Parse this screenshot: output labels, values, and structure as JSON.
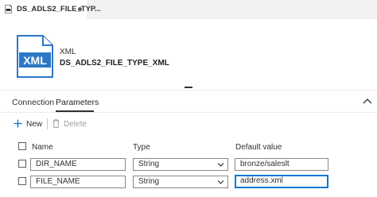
{
  "tab": {
    "title": "DS_ADLS2_FILE_TYP..."
  },
  "dataset": {
    "icon_text": "XML",
    "type_label": "XML",
    "name": "DS_ADLS2_FILE_TYPE_XML"
  },
  "subtabs": [
    {
      "label": "Connection"
    },
    {
      "label": "Parameters"
    }
  ],
  "toolbar": {
    "new_label": "New",
    "delete_label": "Delete"
  },
  "table": {
    "headers": {
      "name": "Name",
      "type": "Type",
      "default": "Default value"
    },
    "rows": [
      {
        "name": "DIR_NAME",
        "type": "String",
        "default": "bronze/saleslt"
      },
      {
        "name": "FILE_NAME",
        "type": "String",
        "default": "address.xml"
      }
    ]
  },
  "colors": {
    "accent": "#0078d4",
    "icon_blue": "#2b78c6"
  },
  "icons": [
    "dataset-tab-icon",
    "xml-file-icon",
    "plus-icon",
    "trash-icon",
    "chevron-up-icon",
    "chevron-down-icon"
  ]
}
